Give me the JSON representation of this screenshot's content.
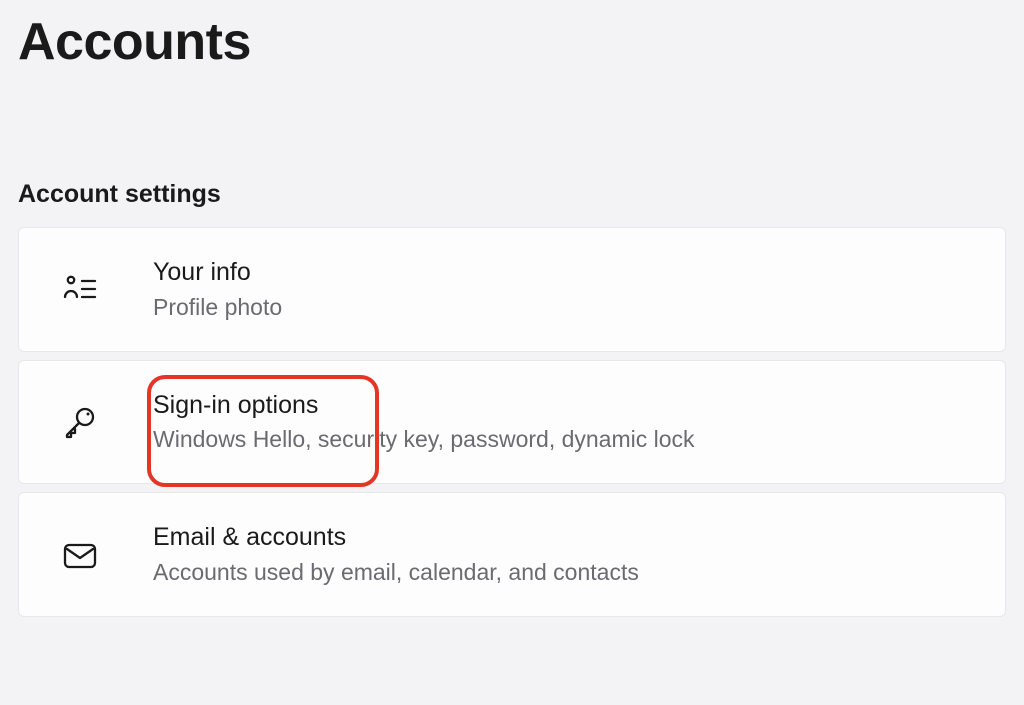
{
  "page": {
    "title": "Accounts"
  },
  "section": {
    "header": "Account settings"
  },
  "items": [
    {
      "title": "Your info",
      "desc": "Profile photo"
    },
    {
      "title": "Sign-in options",
      "desc": "Windows Hello, security key, password, dynamic lock"
    },
    {
      "title": "Email & accounts",
      "desc": "Accounts used by email, calendar, and contacts"
    }
  ]
}
